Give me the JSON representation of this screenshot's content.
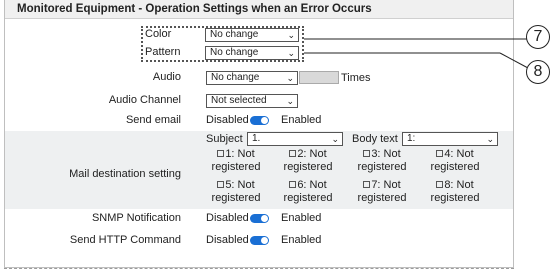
{
  "panel": {
    "title": "Monitored Equipment - Operation Settings when an Error Occurs"
  },
  "color": {
    "label": "Color",
    "value": "No change"
  },
  "pattern": {
    "label": "Pattern",
    "value": "No change"
  },
  "audio": {
    "label": "Audio",
    "value": "No change",
    "times_label": "Times"
  },
  "audio_channel": {
    "label": "Audio Channel",
    "value": "Not selected"
  },
  "send_email": {
    "label": "Send email",
    "off_label": "Disabled",
    "on_label": "Enabled",
    "state": "enabled"
  },
  "mail_destination": {
    "label": "Mail destination setting",
    "subject_label": "Subject",
    "subject_value": "1.",
    "body_label": "Body text",
    "body_value": "1:",
    "destinations": [
      {
        "number": "1",
        "line1": "1: Not",
        "line2": "registered"
      },
      {
        "number": "2",
        "line1": "2: Not",
        "line2": "registered"
      },
      {
        "number": "3",
        "line1": "3: Not",
        "line2": "registered"
      },
      {
        "number": "4",
        "line1": "4: Not",
        "line2": "registered"
      },
      {
        "number": "5",
        "line1": "5: Not",
        "line2": "registered"
      },
      {
        "number": "6",
        "line1": "6: Not",
        "line2": "registered"
      },
      {
        "number": "7",
        "line1": "7: Not",
        "line2": "registered"
      },
      {
        "number": "8",
        "line1": "8: Not",
        "line2": "registered"
      }
    ]
  },
  "snmp": {
    "label": "SNMP Notification",
    "off_label": "Disabled",
    "on_label": "Enabled",
    "state": "enabled"
  },
  "http": {
    "label": "Send HTTP Command",
    "off_label": "Disabled",
    "on_label": "Enabled",
    "state": "enabled"
  },
  "callouts": {
    "c7": "7",
    "c8": "8"
  },
  "colors": {
    "toggle_on": "#1a6fd4",
    "header_bg": "#f0f0f0",
    "row_shade": "#eef0f1"
  }
}
